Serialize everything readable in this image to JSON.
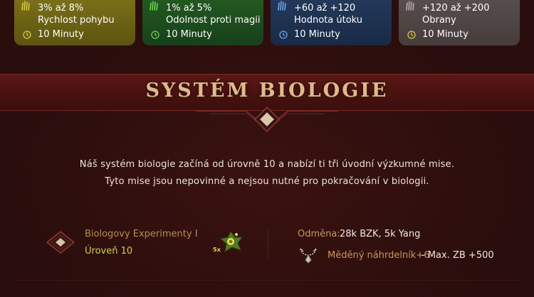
{
  "bonus_cards": [
    {
      "range": "3% až 8%",
      "name": "Rychlost pohybu",
      "duration": "10 Minuty",
      "color": "#6e6314"
    },
    {
      "range": "1% až 5%",
      "name": "Odolnost proti magii",
      "duration": "10 Minuty",
      "color": "#1f4d1f"
    },
    {
      "range": "+60 až +120",
      "name": "Hodnota útoku",
      "duration": "10 Minuty",
      "color": "#1f3352"
    },
    {
      "range": "+120 až +200",
      "name": "Obrany",
      "duration": "10 Minuty",
      "color": "#504646"
    }
  ],
  "section": {
    "title": "SYSTÉM BIOLOGIE",
    "description_line1": "Náš systém biologie začíná od úrovně 10 a nabízí ti tři úvodní výzkumné mise.",
    "description_line2": "Tyto mise jsou nepovinné a nejsou nutné pro pokračování v biologii."
  },
  "mission": {
    "name": "Biologovy Experimenty I",
    "level": "Úroveň 10",
    "item_quantity": "5x",
    "reward_label": "Odměna:",
    "reward_value": "28k BZK, 5k Yang",
    "necklace_name": "Měděný náhrdelník+6",
    "necklace_bonus": "- Max. ZB +500"
  },
  "icons": {
    "card_icon": "claw-icon",
    "clock": "clock-icon",
    "mission": "diamond-icon",
    "item": "flower-item-icon",
    "necklace": "necklace-icon"
  },
  "colors": {
    "background": "#2a0e0d",
    "title": "#e0b98a",
    "label_orange": "#c9955c",
    "level_green": "#c9d44b"
  }
}
